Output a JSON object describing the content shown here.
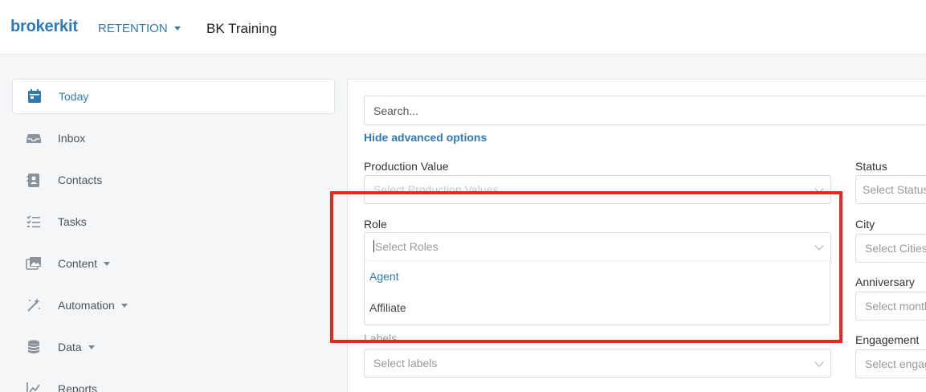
{
  "header": {
    "logo": "brokerkit",
    "module": "RETENTION",
    "account": "BK Training"
  },
  "sidebar": {
    "items": [
      {
        "label": "Today",
        "icon": "calendar-icon",
        "active": true
      },
      {
        "label": "Inbox",
        "icon": "inbox-icon"
      },
      {
        "label": "Contacts",
        "icon": "contact-card-icon"
      },
      {
        "label": "Tasks",
        "icon": "checklist-icon"
      },
      {
        "label": "Content",
        "icon": "images-icon",
        "dropdown": true
      },
      {
        "label": "Automation",
        "icon": "magic-wand-icon",
        "dropdown": true
      },
      {
        "label": "Data",
        "icon": "database-icon",
        "dropdown": true
      },
      {
        "label": "Reports",
        "icon": "chart-icon"
      }
    ]
  },
  "main": {
    "search_placeholder": "Search...",
    "advanced_link": "Hide advanced options",
    "filters": {
      "production_value": {
        "label": "Production Value",
        "placeholder": "Select Production Values"
      },
      "role": {
        "label": "Role",
        "placeholder": "Select Roles",
        "options": [
          "Agent",
          "Affiliate"
        ]
      },
      "labels": {
        "label": "Labels",
        "placeholder": "Select labels"
      },
      "status": {
        "label": "Status",
        "placeholder": "Select Status"
      },
      "city": {
        "label": "City",
        "placeholder": "Select Cities"
      },
      "anniversary": {
        "label": "Anniversary",
        "placeholder": "Select months"
      },
      "engagement": {
        "label": "Engagement",
        "placeholder": "Select engagement"
      }
    }
  },
  "colors": {
    "brand": "#2f7ab5",
    "highlight": "#e8281e"
  }
}
